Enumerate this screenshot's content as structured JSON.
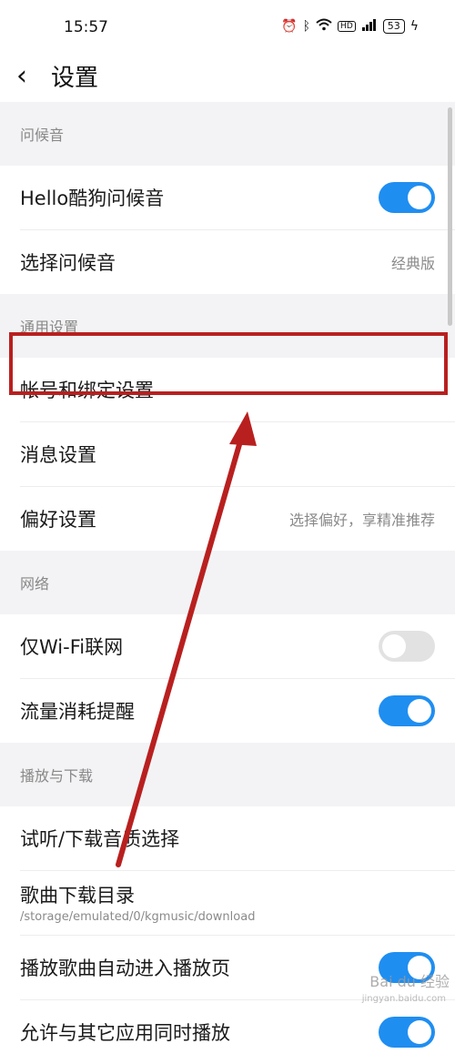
{
  "status_bar": {
    "time": "15:57",
    "icons": [
      "alarm-icon",
      "bluetooth-icon",
      "wifi-icon",
      "hd-icon",
      "signal-icon"
    ],
    "hd_label": "HD",
    "battery": "53"
  },
  "header": {
    "back_icon": "‹",
    "title": "设置"
  },
  "sections": {
    "greeting": {
      "title": "问候音",
      "hello_label": "Hello酷狗问候音",
      "hello_toggle": true,
      "choose_label": "选择问候音",
      "choose_value": "经典版"
    },
    "general": {
      "title": "通用设置",
      "account_label": "帐号和绑定设置",
      "message_label": "消息设置",
      "preference_label": "偏好设置",
      "preference_value": "选择偏好，享精准推荐"
    },
    "network": {
      "title": "网络",
      "wifi_only_label": "仅Wi-Fi联网",
      "wifi_only_toggle": false,
      "data_alert_label": "流量消耗提醒",
      "data_alert_toggle": true
    },
    "playback": {
      "title": "播放与下载",
      "quality_label": "试听/下载音质选择",
      "download_dir_label": "歌曲下载目录",
      "download_dir_value": "/storage/emulated/0/kgmusic/download",
      "auto_play_page_label": "播放歌曲自动进入播放页",
      "auto_play_page_toggle": true,
      "allow_other_label": "允许与其它应用同时播放",
      "allow_other_toggle": true
    }
  },
  "annotation": {
    "highlight_color": "#b8201f",
    "arrow_color": "#b8201f"
  },
  "watermark": {
    "text": "Bai du 经验",
    "sub": "jingyan.baidu.com"
  },
  "colors": {
    "toggle_on": "#1f8ef1",
    "toggle_off": "#e2e2e2",
    "background": "#f3f3f5"
  }
}
